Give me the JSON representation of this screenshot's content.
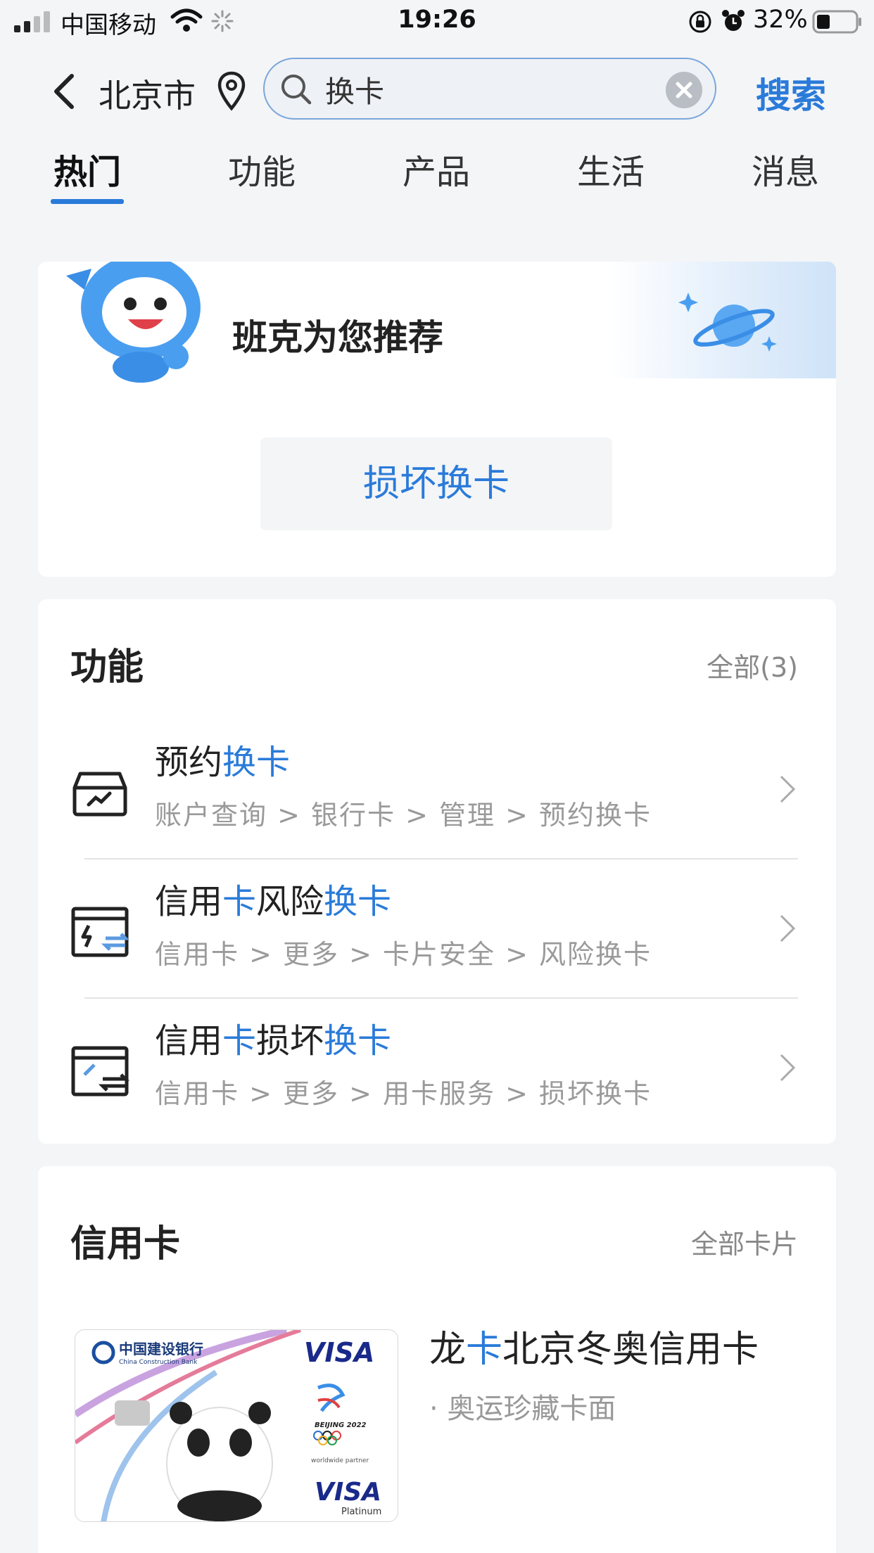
{
  "status_bar": {
    "carrier": "中国移动",
    "time": "19:26",
    "battery": "32%"
  },
  "header": {
    "city": "北京市",
    "search_value": "换卡",
    "search_button": "搜索"
  },
  "tabs": [
    {
      "label": "热门",
      "active": true
    },
    {
      "label": "功能",
      "active": false
    },
    {
      "label": "产品",
      "active": false
    },
    {
      "label": "生活",
      "active": false
    },
    {
      "label": "消息",
      "active": false
    }
  ],
  "recommend": {
    "title": "班克为您推荐",
    "chip": "损坏换卡"
  },
  "functions": {
    "title": "功能",
    "more": "全部(3)",
    "items": [
      {
        "title_a": "预约",
        "title_b": "换卡",
        "title_c": "",
        "title_d": "",
        "path": "账户查询 > 银行卡 > 管理 > 预约换卡",
        "icon": "card-box-icon"
      },
      {
        "title_a": "信用",
        "title_b": "卡",
        "title_c": "风险",
        "title_d": "换卡",
        "path": "信用卡 > 更多 > 卡片安全 > 风险换卡",
        "icon": "risk-swap-icon"
      },
      {
        "title_a": "信用",
        "title_b": "卡",
        "title_c": "损坏",
        "title_d": "换卡",
        "path": "信用卡 > 更多 > 用卡服务 > 损坏换卡",
        "icon": "damage-swap-icon"
      }
    ]
  },
  "credit": {
    "title": "信用卡",
    "more": "全部卡片",
    "card": {
      "name_a": "龙",
      "name_b": "卡",
      "name_c": "北京冬奥信用卡",
      "feature": "· 奥运珍藏卡面",
      "bank_cn": "中国建设银行",
      "bank_en": "China Construction Bank",
      "brand": "VISA",
      "event": "BEIJING 2022",
      "partner": "worldwide partner",
      "tier": "Platinum"
    }
  },
  "colors": {
    "accent": "#2a7bd9",
    "background": "#f4f5f7"
  }
}
